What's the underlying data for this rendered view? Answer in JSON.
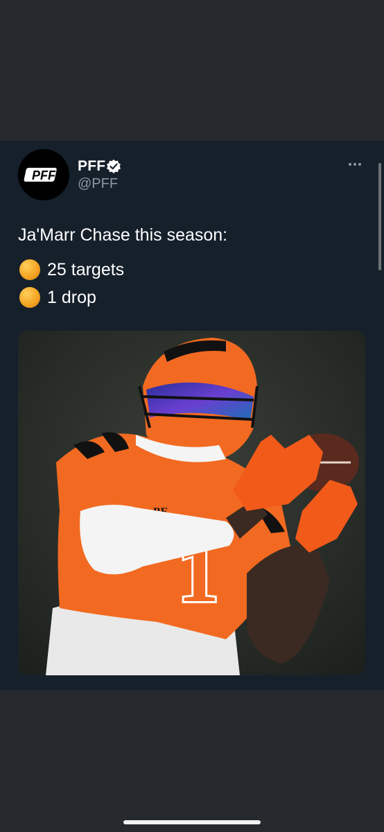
{
  "tweet": {
    "author_name": "PFF",
    "author_handle": "@PFF",
    "avatar_logo_text": "PFF",
    "lines": [
      "Ja'Marr Chase this season:",
      "25 targets",
      "1 drop"
    ],
    "bullet_icon": "orange-circle-emoji",
    "media": {
      "jersey_number": "1",
      "jersey_text": "BE"
    }
  },
  "colors": {
    "background": "#26292d",
    "card": "#15202b",
    "text": "#ffffff",
    "muted": "#8b98a5",
    "jersey_orange": "#f26a21"
  }
}
